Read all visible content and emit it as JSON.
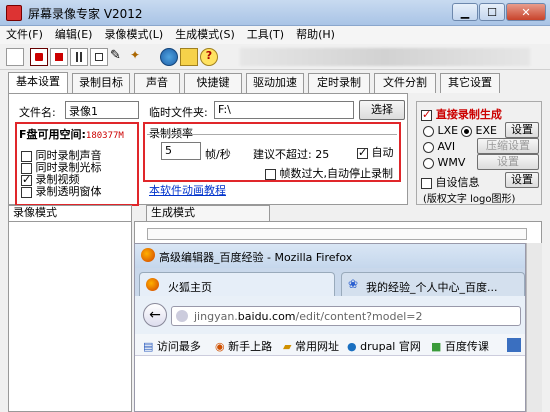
{
  "window": {
    "title": "屏幕录像专家 V2012"
  },
  "menu": [
    "文件(F)",
    "编辑(E)",
    "录像模式(L)",
    "生成模式(S)",
    "工具(T)",
    "帮助(H)"
  ],
  "tabs": [
    "基本设置",
    "录制目标",
    "声音",
    "快捷键",
    "驱动加速",
    "定时录制",
    "文件分割",
    "其它设置"
  ],
  "basic": {
    "filename_label": "文件名:",
    "filename_value": "录像1",
    "tempfolder_label": "临时文件夹:",
    "tempfolder_value": "F:\\",
    "choose_button": "选择",
    "disk_label": "F盘可用空间:",
    "disk_value": "180377M",
    "checks": [
      {
        "label": "同时录制声音",
        "checked": false
      },
      {
        "label": "同时录制光标",
        "checked": false
      },
      {
        "label": "录制视频",
        "checked": true
      },
      {
        "label": "录制透明窗体",
        "checked": false
      }
    ],
    "fps_title": "录制频率",
    "fps_value": "5",
    "fps_unit": "帧/秒",
    "fps_hint": "建议不超过: 25",
    "auto_label": "自动",
    "auto_checked": true,
    "overflow_label": "帧数过大,自动停止录制",
    "overflow_checked": false,
    "tutorial_link": "本软件动画教程"
  },
  "right": {
    "direct_label": "直接录制生成",
    "direct_checked": true,
    "formats": [
      {
        "label": "LXE",
        "checked": false
      },
      {
        "label": "EXE",
        "checked": true
      },
      {
        "label": "AVI",
        "checked": false
      },
      {
        "label": "WMV",
        "checked": false
      }
    ],
    "settings_button": "设置",
    "compress_button": "压缩设置",
    "settings2_button": "设置",
    "auto_info_label": "自设信息",
    "settings3_button": "设置",
    "copyright_text": "(版权文字 logo图形)"
  },
  "lower": {
    "record_mode": "录像模式",
    "generate_mode": "生成模式"
  },
  "firefox": {
    "title": "高级编辑器_百度经验 - Mozilla Firefox",
    "tab1": "火狐主页",
    "tab2": "我的经验_个人中心_百度...",
    "url_prefix": "jingyan.",
    "url_domain": "baidu.com",
    "url_path": "/edit/content?model=2",
    "bookmarks": [
      "访问最多",
      "新手上路",
      "常用网址",
      "drupal 官网",
      "百度传课"
    ]
  }
}
